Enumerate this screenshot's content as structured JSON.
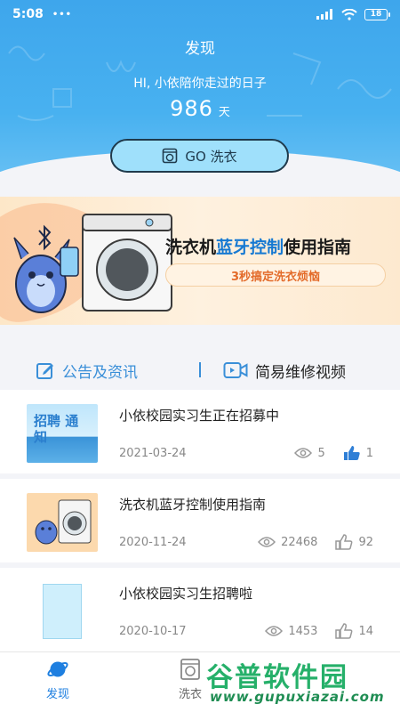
{
  "status_bar": {
    "time": "5:08",
    "dots": "•••",
    "battery": "18"
  },
  "header": {
    "title": "发现",
    "greeting": "HI, 小依陪你走过的日子",
    "days_value": "986",
    "days_unit": "天",
    "go_button_label": "GO 洗衣"
  },
  "banner": {
    "title_part1": "洗衣机",
    "title_highlight": "蓝牙控制",
    "title_part2": "使用指南",
    "subtitle": "3秒搞定洗衣烦恼"
  },
  "tabs": [
    {
      "label": "公告及资讯",
      "icon": "edit-icon",
      "active": true
    },
    {
      "label": "简易维修视频",
      "icon": "video-icon",
      "active": false
    }
  ],
  "articles": [
    {
      "title": "小依校园实习生正在招募中",
      "date": "2021-03-24",
      "views": "5",
      "likes": "1",
      "thumb_text": "招聘 通知"
    },
    {
      "title": "洗衣机蓝牙控制使用指南",
      "date": "2020-11-24",
      "views": "22468",
      "likes": "92"
    },
    {
      "title": "小依校园实习生招聘啦",
      "date": "2020-10-17",
      "views": "1453",
      "likes": "14"
    }
  ],
  "bottom_nav": [
    {
      "label": "发现",
      "icon": "planet-icon",
      "active": true
    },
    {
      "label": "洗衣",
      "icon": "washer-icon",
      "active": false
    }
  ],
  "watermark": {
    "main": "谷普软件园",
    "url": "www.gupuxiazai.com"
  },
  "colors": {
    "header_blue": "#48b1f0",
    "accent_blue": "#3a8fd8",
    "watermark_green": "#26b06a"
  }
}
